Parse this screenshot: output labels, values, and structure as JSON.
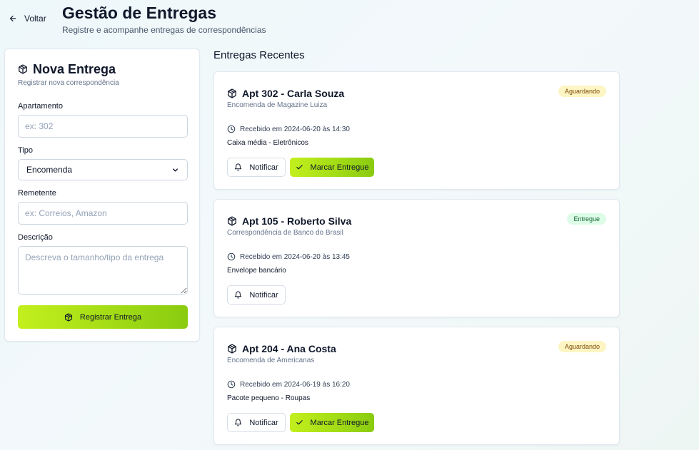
{
  "header": {
    "back_label": "Voltar",
    "title": "Gestão de Entregas",
    "subtitle": "Registre e acompanhe entregas de correspondências"
  },
  "form": {
    "title": "Nova Entrega",
    "subtitle": "Registrar nova correspondência",
    "apartment": {
      "label": "Apartamento",
      "placeholder": "ex: 302",
      "value": ""
    },
    "type": {
      "label": "Tipo",
      "selected": "Encomenda"
    },
    "sender": {
      "label": "Remetente",
      "placeholder": "ex: Correios, Amazon",
      "value": ""
    },
    "description": {
      "label": "Descrição",
      "placeholder": "Descreva o tamanho/tipo da entrega",
      "value": ""
    },
    "submit_label": "Registrar Entrega"
  },
  "recent": {
    "title": "Entregas Recentes",
    "notify_label": "Notificar",
    "deliver_label": "Marcar Entregue",
    "items": [
      {
        "title": "Apt 302 - Carla Souza",
        "subtitle": "Encomenda de Magazine Luiza",
        "received": "Recebido em 2024-06-20 às 14:30",
        "description": "Caixa média - Eletrônicos",
        "status": "Aguardando"
      },
      {
        "title": "Apt 105 - Roberto Silva",
        "subtitle": "Correspondência de Banco do Brasil",
        "received": "Recebido em 2024-06-20 às 13:45",
        "description": "Envelope bancário",
        "status": "Entregue"
      },
      {
        "title": "Apt 204 - Ana Costa",
        "subtitle": "Encomenda de Americanas",
        "received": "Recebido em 2024-06-19 às 16:20",
        "description": "Pacote pequeno - Roupas",
        "status": "Aguardando"
      }
    ]
  },
  "colors": {
    "accent_start": "#c3ef1d",
    "accent_end": "#8acb10",
    "waiting_badge_bg": "#fdf5c3",
    "delivered_badge_bg": "#dcfce7"
  },
  "icons": {
    "back": "arrow-left-icon",
    "package": "package-icon",
    "clock": "clock-icon",
    "bell": "bell-icon",
    "check": "check-icon",
    "select": "chevron-down-icon"
  }
}
